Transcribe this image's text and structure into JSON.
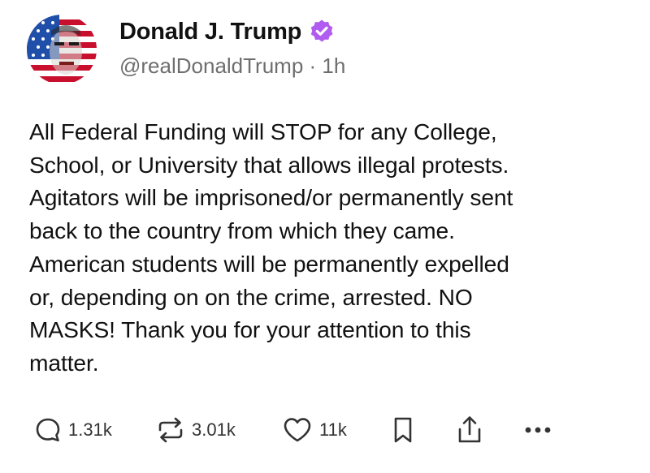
{
  "author": {
    "display_name": "Donald J. Trump",
    "handle": "@realDonaldTrump",
    "separator": "·",
    "time_ago": "1h",
    "avatar": "american-flag-portrait-avatar",
    "verified_badge_icon": "verified-badge-icon",
    "badge_color": "#b05cf0"
  },
  "post": {
    "text": "All Federal Funding will STOP for any College,\nSchool, or University that allows illegal protests.\nAgitators will be imprisoned/or permanently sent\nback to the country from which they came.\nAmerican students will be permanently expelled\nor, depending on on the crime, arrested. NO\nMASKS! Thank you for your attention to this\nmatter."
  },
  "actions": {
    "reply": {
      "icon": "comment-icon",
      "count": "1.31k"
    },
    "repost": {
      "icon": "repost-icon",
      "count": "3.01k"
    },
    "like": {
      "icon": "heart-icon",
      "count": "11k"
    },
    "bookmark": {
      "icon": "bookmark-icon"
    },
    "share": {
      "icon": "share-icon"
    },
    "more": {
      "icon": "more-icon"
    }
  },
  "colors": {
    "text": "#111111",
    "secondary_text": "#6e6e6e",
    "icon": "#333333",
    "background": "#ffffff"
  }
}
